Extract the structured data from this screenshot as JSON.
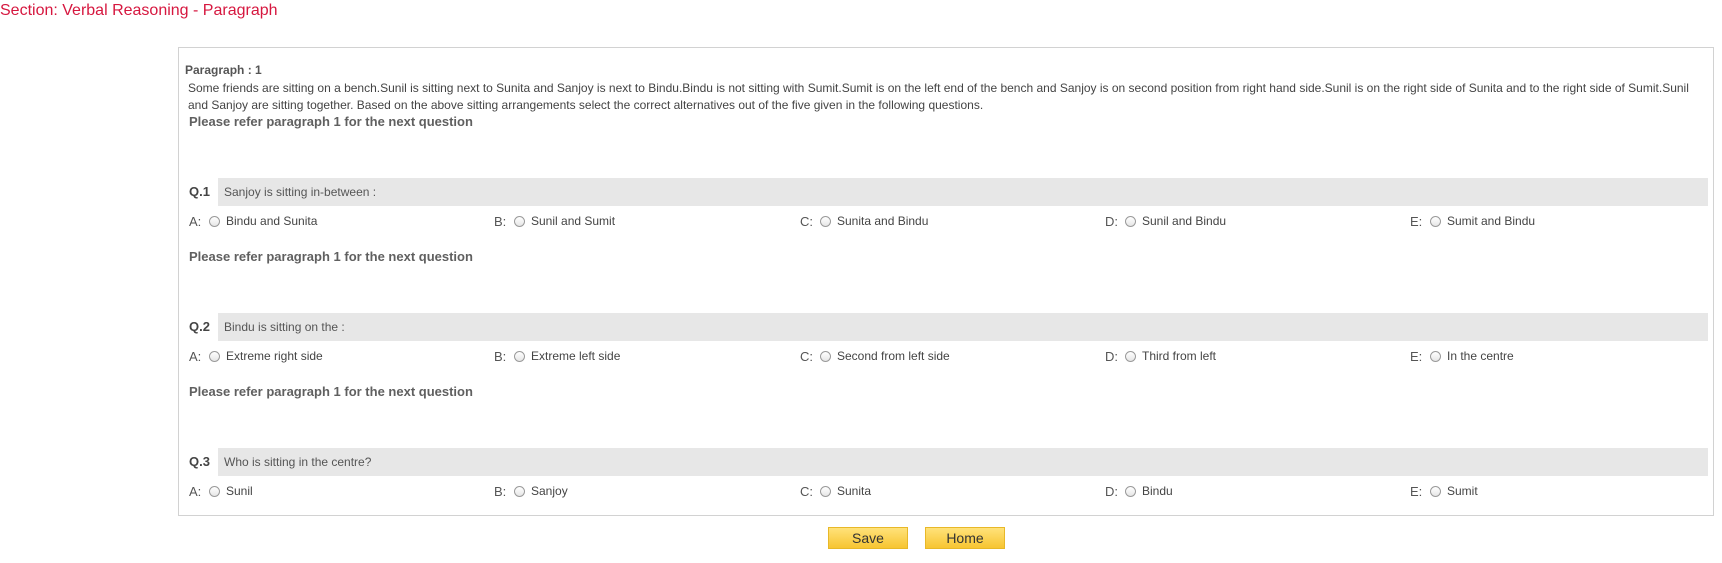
{
  "section_title": "Section: Verbal Reasoning - Paragraph",
  "paragraph": {
    "heading": "Paragraph : 1",
    "text": "Some friends are sitting on a bench.Sunil is sitting next to Sunita and Sanjoy is next to Bindu.Bindu is not sitting with Sumit.Sumit is on the left end of the bench and Sanjoy is on second position from right hand side.Sunil is on the right side of Sunita and to the right side of Sumit.Sunil and Sanjoy are sitting together. Based on the above sitting arrangements select the correct alternatives out of the five given in the following questions."
  },
  "questions": [
    {
      "refer": "Please refer paragraph 1 for the next question",
      "number": "Q.1",
      "text": "Sanjoy is sitting in-between :",
      "options": [
        {
          "letter": "A:",
          "label": "Bindu and Sunita"
        },
        {
          "letter": "B:",
          "label": "Sunil and Sumit"
        },
        {
          "letter": "C:",
          "label": "Sunita and Bindu"
        },
        {
          "letter": "D:",
          "label": "Sunil and Bindu"
        },
        {
          "letter": "E:",
          "label": "Sumit and Bindu"
        }
      ]
    },
    {
      "refer": "Please refer paragraph 1 for the next question",
      "number": "Q.2",
      "text": "Bindu is sitting on the :",
      "options": [
        {
          "letter": "A:",
          "label": "Extreme right side"
        },
        {
          "letter": "B:",
          "label": "Extreme left side"
        },
        {
          "letter": "C:",
          "label": "Second from left side"
        },
        {
          "letter": "D:",
          "label": "Third from left"
        },
        {
          "letter": "E:",
          "label": "In the centre"
        }
      ]
    },
    {
      "refer": "Please refer paragraph 1 for the next question",
      "number": "Q.3",
      "text": "Who is sitting in the centre?",
      "options": [
        {
          "letter": "A:",
          "label": "Sunil"
        },
        {
          "letter": "B:",
          "label": "Sanjoy"
        },
        {
          "letter": "C:",
          "label": "Sunita"
        },
        {
          "letter": "D:",
          "label": "Bindu"
        },
        {
          "letter": "E:",
          "label": "Sumit"
        }
      ]
    }
  ],
  "buttons": {
    "save": "Save",
    "home": "Home"
  }
}
